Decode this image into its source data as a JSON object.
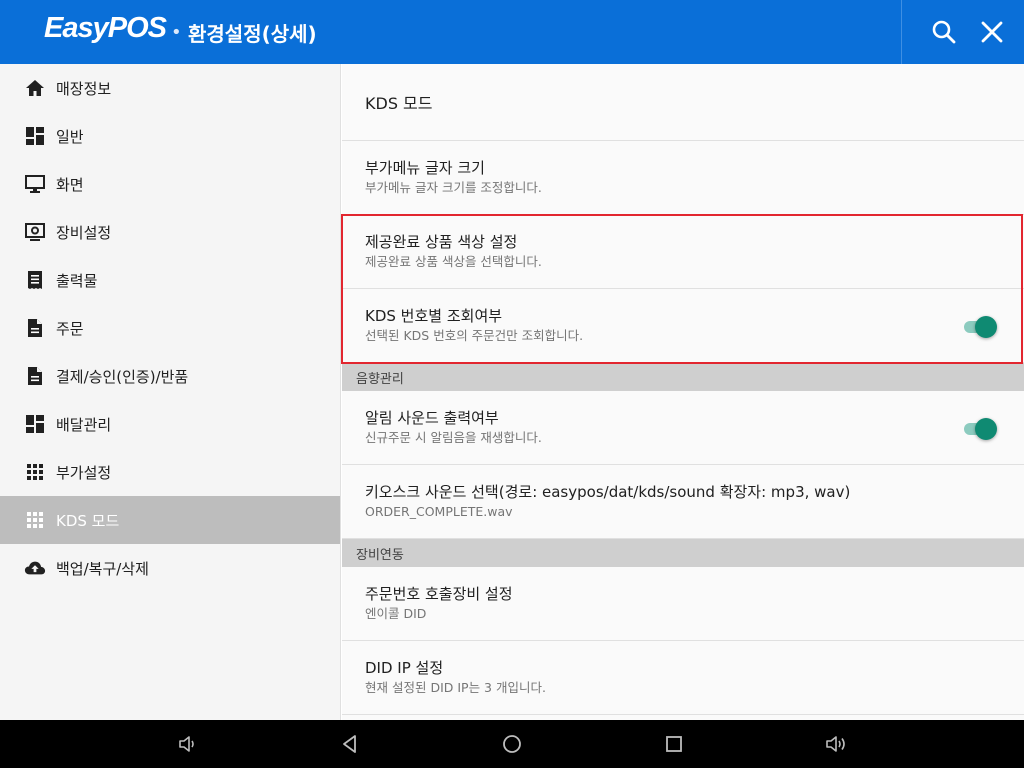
{
  "header": {
    "brand": "EasyPOS",
    "separator": "•",
    "title": "환경설정(상세)",
    "color": "#0a6fd8",
    "search_icon": "search-icon",
    "close_icon": "close-icon"
  },
  "sidebar": {
    "items": [
      {
        "label": "매장정보",
        "icon": "home-icon"
      },
      {
        "label": "일반",
        "icon": "dashboard-icon"
      },
      {
        "label": "화면",
        "icon": "monitor-icon"
      },
      {
        "label": "장비설정",
        "icon": "device-settings-icon"
      },
      {
        "label": "출력물",
        "icon": "receipt-icon"
      },
      {
        "label": "주문",
        "icon": "document-icon"
      },
      {
        "label": "결제/승인(인증)/반품",
        "icon": "document-icon"
      },
      {
        "label": "배달관리",
        "icon": "dashboard-icon"
      },
      {
        "label": "부가설정",
        "icon": "grid-icon"
      },
      {
        "label": "KDS 모드",
        "icon": "grid-icon",
        "active": true
      },
      {
        "label": "백업/복구/삭제",
        "icon": "cloud-upload-icon"
      }
    ]
  },
  "main": {
    "title": "KDS 모드",
    "prefs": [
      {
        "title": "부가메뉴 글자 크기",
        "summary": "부가메뉴 글자 크기를 조정합니다."
      },
      {
        "title": "제공완료 상품 색상 설정",
        "summary": "제공완료 상품 색상을 선택합니다."
      },
      {
        "title": "KDS 번호별 조회여부",
        "summary": "선택된 KDS 번호의 주문건만 조회합니다.",
        "toggle": "on"
      }
    ],
    "sections": [
      {
        "label": "음향관리",
        "prefs": [
          {
            "title": "알림 사운드 출력여부",
            "summary": "신규주문 시 알림음을 재생합니다.",
            "toggle": "on"
          },
          {
            "title": "키오스크 사운드 선택(경로: easypos/dat/kds/sound 확장자: mp3, wav)",
            "summary": "ORDER_COMPLETE.wav"
          }
        ]
      },
      {
        "label": "장비연동",
        "prefs": [
          {
            "title": "주문번호 호출장비 설정",
            "summary": "엔이콜 DID"
          },
          {
            "title": "DID IP 설정",
            "summary": "현재 설정된 DID IP는 3 개입니다."
          }
        ]
      }
    ],
    "toggle_color": "#0f8a72",
    "highlight_color": "#e2262f"
  },
  "navbar": {
    "buttons": [
      "volume-down-icon",
      "back-icon",
      "home-circle-icon",
      "recents-icon",
      "volume-up-icon"
    ]
  }
}
